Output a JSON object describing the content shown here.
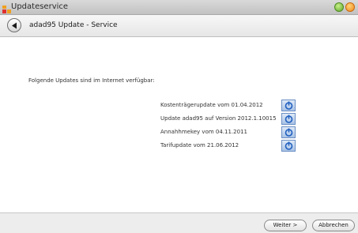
{
  "window": {
    "title": "Updateservice"
  },
  "header": {
    "title": "adad95 Update - Service"
  },
  "main": {
    "intro": "Folgende Updates sind im Internet verfügbar:",
    "updates": [
      {
        "label": "Kostenträgerupdate vom 01.04.2012"
      },
      {
        "label": "Update adad95 auf Version 2012.1.10015"
      },
      {
        "label": "Annahhmekey vom 04.11.2011"
      },
      {
        "label": "Tarifupdate vom 21.06.2012"
      }
    ]
  },
  "footer": {
    "next_label": "Weiter >",
    "cancel_label": "Abbrechen"
  },
  "colors": {
    "accent": "#6b8fc4",
    "download_icon": "#1f5fbf"
  }
}
